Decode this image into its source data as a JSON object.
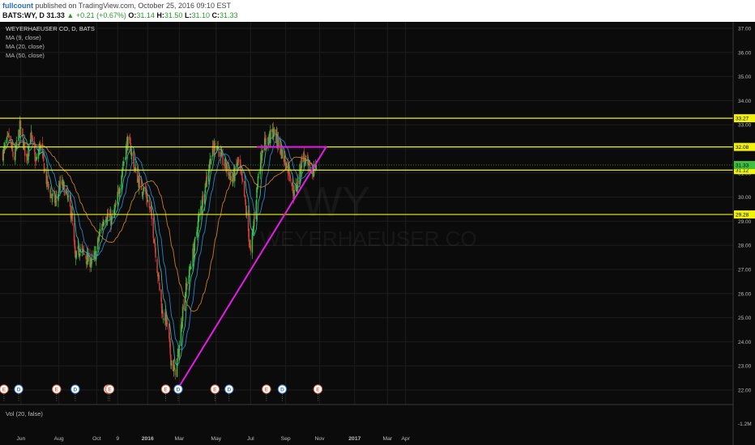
{
  "header": {
    "author": "fullcount",
    "published": "published on TradingView.com, October 25, 2016 09:10 EST",
    "symbol": "BATS:WY, D",
    "last": "31.33",
    "change": "▲ +0.21 (+0.67%)",
    "o_label": "O:",
    "o": "31.14",
    "h_label": "H:",
    "h": "31.50",
    "l_label": "L:",
    "l": "31.10",
    "c_label": "C:",
    "c": "31.33"
  },
  "legend": {
    "title": "WEYERHAEUSER CO, D, BATS",
    "ma9": "MA (9, close)",
    "ma20": "MA (20, close)",
    "ma50": "MA (50, close)"
  },
  "watermark": {
    "ticker": "WY",
    "name": "WEYERHAEUSER CO"
  },
  "volume_label": "Vol (20, false)",
  "volume_axis_label": "-1.2M",
  "colors": {
    "background": "#0b0b0b",
    "grid": "#1e1e1e",
    "up": "#3fbf3f",
    "down": "#d83b3b",
    "ma9": "#2fb6ad",
    "ma20": "#2f7fc4",
    "ma50": "#c87a2a",
    "support_lines": "#f2f20a",
    "trendline": "#e81ae8",
    "last_price_tag": "#3fbf3f"
  },
  "chart_data": {
    "type": "candlestick",
    "symbol": "BATS:WY",
    "interval": "D",
    "x_tick_labels": [
      "Jun",
      "Aug",
      "Oct",
      "9",
      "2016",
      "Mar",
      "May",
      "Jul",
      "Sep",
      "Nov",
      "2017",
      "Mar",
      "Apr"
    ],
    "y_tick_labels": [
      "22.00",
      "23.00",
      "24.00",
      "25.00",
      "26.00",
      "27.00",
      "28.00",
      "29.00",
      "30.00",
      "31.00",
      "32.00",
      "33.00",
      "34.00",
      "35.00",
      "36.00",
      "37.00"
    ],
    "ylim": [
      21.6,
      37.5
    ],
    "price_path": [
      [
        "2015-04-20",
        31.8
      ],
      [
        "2015-05-01",
        32.5
      ],
      [
        "2015-05-10",
        31.5
      ],
      [
        "2015-05-20",
        32.9
      ],
      [
        "2015-06-01",
        31.6
      ],
      [
        "2015-06-08",
        32.6
      ],
      [
        "2015-06-18",
        31.4
      ],
      [
        "2015-06-25",
        32.2
      ],
      [
        "2015-07-05",
        30.8
      ],
      [
        "2015-07-12",
        30.2
      ],
      [
        "2015-07-22",
        29.8
      ],
      [
        "2015-08-01",
        30.6
      ],
      [
        "2015-08-10",
        30.2
      ],
      [
        "2015-08-20",
        29.2
      ],
      [
        "2015-08-26",
        27.4
      ],
      [
        "2015-09-03",
        27.9
      ],
      [
        "2015-09-14",
        27.5
      ],
      [
        "2015-09-24",
        27.3
      ],
      [
        "2015-10-01",
        27.6
      ],
      [
        "2015-10-09",
        28.6
      ],
      [
        "2015-10-19",
        29.3
      ],
      [
        "2015-10-29",
        29.0
      ],
      [
        "2015-11-06",
        29.6
      ],
      [
        "2015-11-16",
        31.0
      ],
      [
        "2015-11-26",
        32.3
      ],
      [
        "2015-12-02",
        32.0
      ],
      [
        "2015-12-10",
        31.1
      ],
      [
        "2015-12-18",
        30.5
      ],
      [
        "2015-12-28",
        30.2
      ],
      [
        "2016-01-06",
        29.4
      ],
      [
        "2016-01-13",
        28.2
      ],
      [
        "2016-01-20",
        26.6
      ],
      [
        "2016-01-27",
        25.2
      ],
      [
        "2016-02-04",
        24.8
      ],
      [
        "2016-02-11",
        23.3
      ],
      [
        "2016-02-18",
        22.7
      ],
      [
        "2016-02-25",
        23.6
      ],
      [
        "2016-03-04",
        25.6
      ],
      [
        "2016-03-14",
        26.8
      ],
      [
        "2016-03-24",
        28.0
      ],
      [
        "2016-04-01",
        29.2
      ],
      [
        "2016-04-11",
        30.4
      ],
      [
        "2016-04-21",
        31.6
      ],
      [
        "2016-05-01",
        32.3
      ],
      [
        "2016-05-10",
        31.6
      ],
      [
        "2016-05-20",
        31.2
      ],
      [
        "2016-05-30",
        30.7
      ],
      [
        "2016-06-09",
        31.5
      ],
      [
        "2016-06-19",
        30.2
      ],
      [
        "2016-06-27",
        28.6
      ],
      [
        "2016-07-01",
        27.6
      ],
      [
        "2016-07-06",
        28.8
      ],
      [
        "2016-07-14",
        30.8
      ],
      [
        "2016-07-22",
        32.1
      ],
      [
        "2016-08-01",
        32.4
      ],
      [
        "2016-08-10",
        32.7
      ],
      [
        "2016-08-20",
        32.2
      ],
      [
        "2016-08-29",
        31.6
      ],
      [
        "2016-09-08",
        31.0
      ],
      [
        "2016-09-16",
        30.1
      ],
      [
        "2016-09-24",
        30.8
      ],
      [
        "2016-10-01",
        31.8
      ],
      [
        "2016-10-09",
        31.3
      ],
      [
        "2016-10-17",
        31.0
      ],
      [
        "2016-10-25",
        31.33
      ]
    ],
    "horizontal_levels": [
      {
        "price": 33.27,
        "label": "33.27"
      },
      {
        "price": 32.08,
        "label": "32.08"
      },
      {
        "price": 31.12,
        "label": "31.12"
      },
      {
        "price": 29.28,
        "label": "29.28"
      }
    ],
    "last_price": {
      "price": 31.33,
      "label": "31.33"
    },
    "trendlines": [
      {
        "from": [
          "2016-02-22",
          22.0
        ],
        "to": [
          "2016-11-12",
          32.1
        ],
        "name": "rising support"
      },
      {
        "from": [
          "2016-07-12",
          32.08
        ],
        "to": [
          "2016-11-12",
          32.08
        ],
        "name": "resistance"
      }
    ],
    "event_markers": [
      {
        "date": "2015-04-22",
        "kind": "E"
      },
      {
        "date": "2015-05-18",
        "kind": "D"
      },
      {
        "date": "2015-07-24",
        "kind": "E"
      },
      {
        "date": "2015-08-26",
        "kind": "D"
      },
      {
        "date": "2015-10-23",
        "kind": "E"
      },
      {
        "date": "2015-10-26",
        "kind": "E"
      },
      {
        "date": "2016-02-02",
        "kind": "E"
      },
      {
        "date": "2016-02-24",
        "kind": "D"
      },
      {
        "date": "2016-04-29",
        "kind": "E"
      },
      {
        "date": "2016-05-24",
        "kind": "D"
      },
      {
        "date": "2016-07-29",
        "kind": "E"
      },
      {
        "date": "2016-08-26",
        "kind": "D"
      },
      {
        "date": "2016-10-28",
        "kind": "E"
      }
    ],
    "moving_averages": [
      {
        "period": 9,
        "label": "MA (9, close)"
      },
      {
        "period": 20,
        "label": "MA (20, close)"
      },
      {
        "period": 50,
        "label": "MA (50, close)"
      }
    ]
  }
}
